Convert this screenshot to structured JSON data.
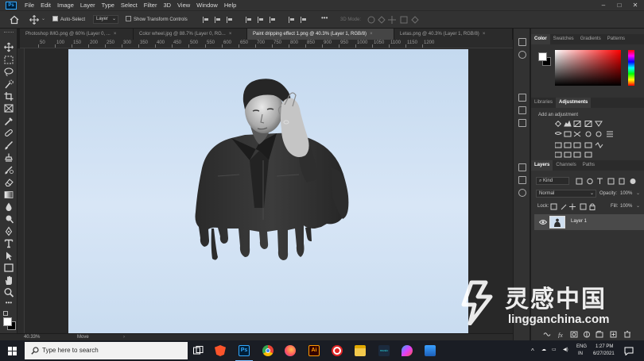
{
  "menubar": {
    "items": [
      "File",
      "Edit",
      "Image",
      "Layer",
      "Type",
      "Select",
      "Filter",
      "3D",
      "View",
      "Window",
      "Help"
    ],
    "window_controls": [
      "–",
      "□",
      "✕"
    ]
  },
  "options": {
    "auto_select_label": "Auto-Select",
    "auto_select_target": "Layer",
    "transform_label": "Show Transform Controls",
    "more_label": "•••",
    "mode_3d_label": "3D Mode:"
  },
  "tabs": [
    {
      "label": "Photoshop IMG.png @ 60% (Layer 0, ...",
      "active": false
    },
    {
      "label": "Color wheel.jpg @ 88.7% (Layer 0, RG...",
      "active": false
    },
    {
      "label": "Paint dripping effect 1.png @ 40.3% (Layer 1, RGB/8)",
      "active": true
    },
    {
      "label": "Letas.png @ 40.3% (Layer 1, RGB/8)",
      "active": false
    }
  ],
  "ruler_ticks": [
    "50",
    "100",
    "150",
    "200",
    "250",
    "300",
    "350",
    "400",
    "450",
    "500",
    "550",
    "600",
    "650",
    "700",
    "750",
    "800",
    "850",
    "900",
    "950",
    "1000",
    "1050",
    "1100",
    "1150",
    "1200"
  ],
  "status": {
    "zoom": "40.33%",
    "info": "Move"
  },
  "color_panel": {
    "tabs": [
      "Color",
      "Swatches",
      "Gradients",
      "Patterns"
    ],
    "foreground": "#ffffff",
    "background": "#000000",
    "hue_color": "#ff0000"
  },
  "adjustments_panel": {
    "tabs": [
      "Libraries",
      "Adjustments"
    ],
    "heading": "Add an adjustment"
  },
  "layers_panel": {
    "tabs": [
      "Layers",
      "Channels",
      "Paths"
    ],
    "filter_kind": "Kind",
    "blend_mode": "Normal",
    "opacity_label": "Opacity:",
    "opacity_value": "100%",
    "lock_label": "Lock:",
    "fill_label": "Fill:",
    "fill_value": "100%",
    "layers": [
      {
        "name": "Layer 1",
        "visible": true
      }
    ]
  },
  "taskbar": {
    "search_placeholder": "Type here to search",
    "apps": [
      "task-view",
      "brave",
      "photoshop",
      "chrome",
      "firefox",
      "illustrator",
      "screen-recorder",
      "file-explorer",
      "amazon-music",
      "color-app",
      "photos"
    ],
    "lang_top": "ENG",
    "lang_bottom": "IN",
    "time": "1:27 PM",
    "date": "6/27/2021"
  },
  "watermark": {
    "cn": "灵感中国",
    "url": "lingganchina.com"
  }
}
